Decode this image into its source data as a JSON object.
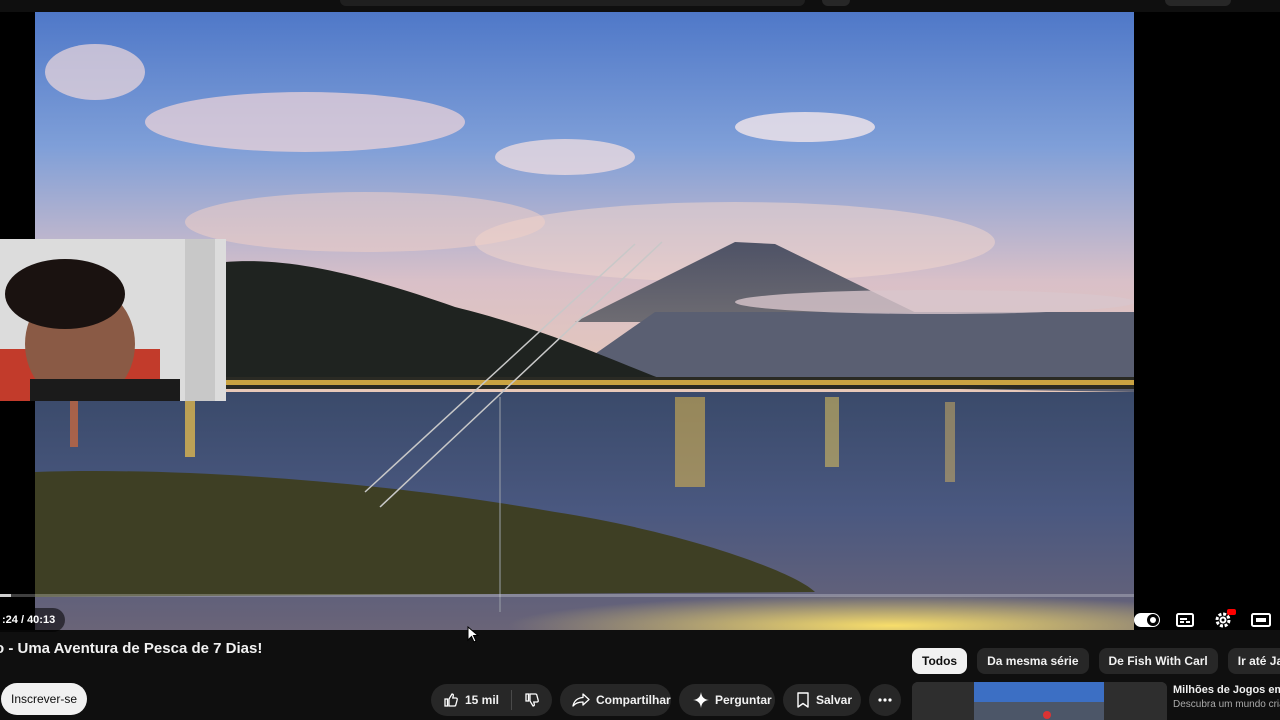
{
  "player": {
    "time_display": ":24 / 40:13",
    "progress_fraction": 0.01
  },
  "video": {
    "title": "o - Uma Aventura de Pesca de 7 Dias!"
  },
  "channel": {
    "subscribe_label": "Inscrever-se"
  },
  "actions": {
    "likes": "15 mil",
    "share_label": "Compartilhar",
    "ask_label": "Perguntar",
    "save_label": "Salvar"
  },
  "chips": [
    {
      "label": "Todos",
      "active": true
    },
    {
      "label": "Da mesma série",
      "active": false
    },
    {
      "label": "De Fish With Carl",
      "active": false
    },
    {
      "label": "Ir até Japão",
      "active": false
    }
  ],
  "recommendation": {
    "title": "Milhões de Jogos em",
    "description": "Descubra um mundo cria"
  },
  "colors": {
    "background": "#0f0f0f",
    "pill": "#272727",
    "text": "#f1f1f1",
    "accent": "#ff0000"
  },
  "icons": {
    "autoplay": "autoplay-toggle-icon",
    "subtitles": "subtitles-icon",
    "settings": "settings-icon",
    "theater": "theater-mode-icon",
    "like": "thumbs-up-icon",
    "dislike": "thumbs-down-icon",
    "share": "share-icon",
    "ask": "sparkle-icon",
    "save": "bookmark-icon",
    "more": "more-horizontal-icon"
  }
}
